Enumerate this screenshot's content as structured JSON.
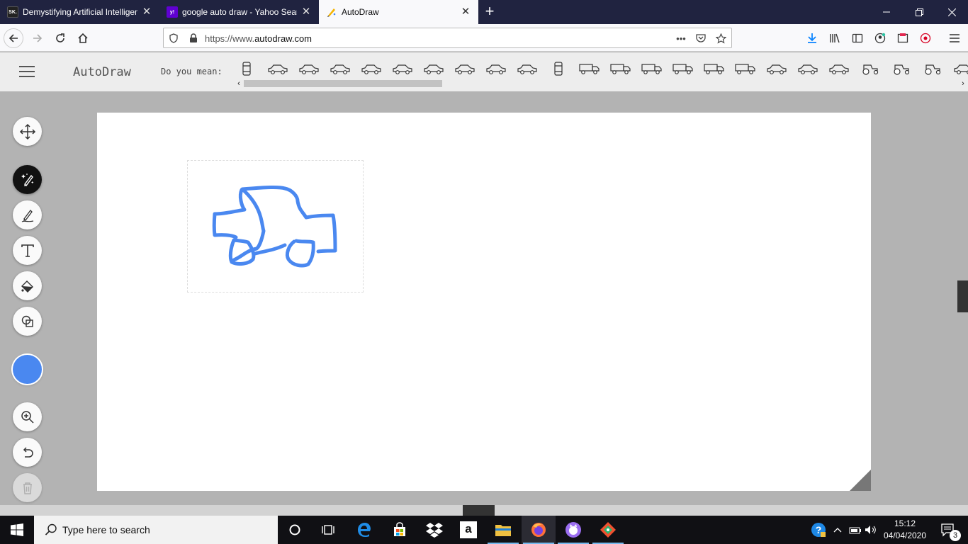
{
  "browser": {
    "tabs": [
      {
        "title": "Demystifying Artificial Intelligence",
        "favicon": "SK."
      },
      {
        "title": "google auto draw - Yahoo Search",
        "favicon": "y!"
      },
      {
        "title": "AutoDraw",
        "favicon": "autodraw-icon"
      }
    ],
    "url_prefix": "https://www.",
    "url_domain": "autodraw.com",
    "new_tab": "+"
  },
  "app": {
    "name": "AutoDraw",
    "suggestion_prompt": "Do you mean:",
    "suggestions": [
      "car-top-view",
      "race-car",
      "sports-car",
      "small-car",
      "coupe",
      "sedan",
      "hatchback",
      "classic-car",
      "suv",
      "limousine",
      "car-front",
      "bus",
      "trolley",
      "fire-truck",
      "long-truck",
      "tow-truck",
      "semi-truck",
      "pickup",
      "jeep",
      "wagon",
      "tractor",
      "farm-tractor",
      "tractor-with-arm",
      "minivan"
    ],
    "tools": [
      "move",
      "autodraw",
      "draw",
      "type",
      "fill",
      "shape",
      "color",
      "zoom",
      "undo",
      "delete"
    ],
    "current_color": "#4A88F0"
  },
  "taskbar": {
    "search_placeholder": "Type here to search",
    "time": "15:12",
    "date": "04/04/2020",
    "notification_count": "3"
  }
}
